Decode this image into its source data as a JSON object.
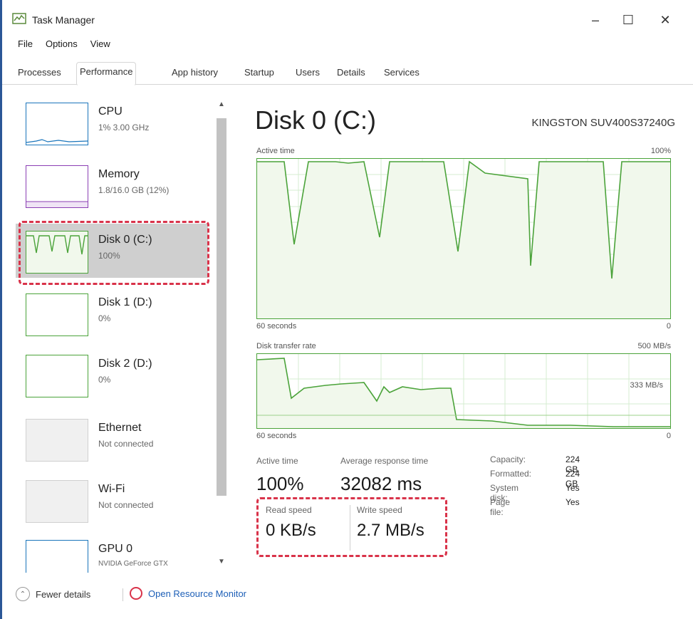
{
  "window": {
    "title": "Task Manager",
    "minimize": "–",
    "maximize": "☐",
    "close": "✕"
  },
  "menu": [
    "File",
    "Options",
    "View"
  ],
  "tabs": [
    "Processes",
    "Performance",
    "App history",
    "Startup",
    "Users",
    "Details",
    "Services"
  ],
  "active_tab": "Performance",
  "sidebar": {
    "items": [
      {
        "name": "CPU",
        "sub": "1% 3.00 GHz"
      },
      {
        "name": "Memory",
        "sub": "1.8/16.0 GB (12%)"
      },
      {
        "name": "Disk 0 (C:)",
        "sub": "100%"
      },
      {
        "name": "Disk 1 (D:)",
        "sub": "0%"
      },
      {
        "name": "Disk 2 (D:)",
        "sub": "0%"
      },
      {
        "name": "Ethernet",
        "sub": "Not connected"
      },
      {
        "name": "Wi-Fi",
        "sub": "Not connected"
      },
      {
        "name": "GPU 0",
        "sub": "NVIDIA GeForce GTX"
      }
    ],
    "selected_index": 2
  },
  "main": {
    "title": "Disk 0 (C:)",
    "model": "KINGSTON SUV400S37240G",
    "active_time_graph": {
      "label": "Active time",
      "max": "100%",
      "x_left": "60 seconds",
      "x_right": "0"
    },
    "transfer_graph": {
      "label": "Disk transfer rate",
      "max": "500 MB/s",
      "mid": "333 MB/s",
      "x_left": "60 seconds",
      "x_right": "0"
    },
    "stats": {
      "active_time_label": "Active time",
      "active_time_value": "100%",
      "avg_response_label": "Average response time",
      "avg_response_value": "32082 ms",
      "read_label": "Read speed",
      "read_value": "0 KB/s",
      "write_label": "Write speed",
      "write_value": "2.7 MB/s"
    },
    "properties": [
      {
        "key": "Capacity:",
        "value": "224 GB"
      },
      {
        "key": "Formatted:",
        "value": "224 GB"
      },
      {
        "key": "System disk:",
        "value": "Yes"
      },
      {
        "key": "Page file:",
        "value": "Yes"
      }
    ]
  },
  "footer": {
    "fewer_details": "Fewer details",
    "open_resource_monitor": "Open Resource Monitor"
  },
  "colors": {
    "disk_green": "#4ba33a",
    "highlight_red": "#d9334a",
    "link_blue": "#1d5fb7",
    "cpu_blue": "#1a75bb",
    "memory_purple": "#8b3fb4"
  }
}
